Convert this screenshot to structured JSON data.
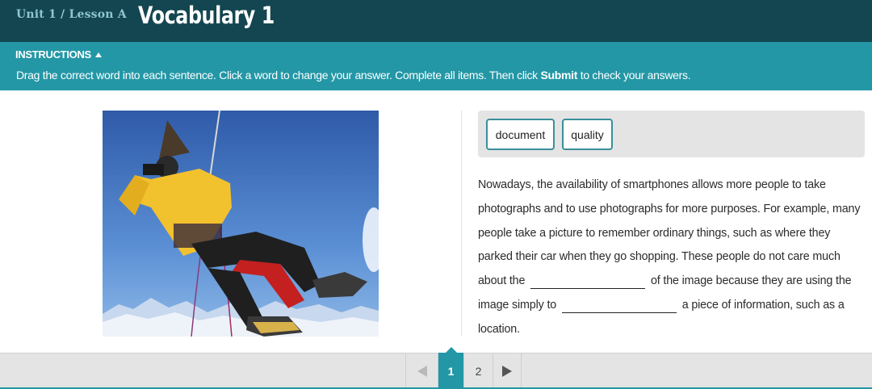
{
  "header": {
    "unit_lesson": "Unit 1 / Lesson A",
    "title": "Vocabulary 1"
  },
  "instructions": {
    "toggle_label": "INSTRUCTIONS",
    "text_before": "Drag the correct word into each sentence. Click a word to change your answer. Complete all items. Then click ",
    "text_bold": "Submit",
    "text_after": " to check your answers."
  },
  "photo": {
    "icon": "climber-photo"
  },
  "word_bank": {
    "words": [
      "document",
      "quality"
    ]
  },
  "passage": {
    "part1": "Nowadays, the availability of smartphones allows more people to take photographs and to use photographs for more purposes. For example, many people take a picture to remember ordinary things, such as where they parked their car when they go shopping. These people do not care much about the",
    "part2": "of the image because they are using the image simply to",
    "part3": "a piece of information, such as a location."
  },
  "pagination": {
    "pages": [
      "1",
      "2"
    ],
    "current": "1"
  },
  "colors": {
    "header_bg": "#134650",
    "accent": "#2397a6",
    "chip_border": "#3a8f9a"
  }
}
